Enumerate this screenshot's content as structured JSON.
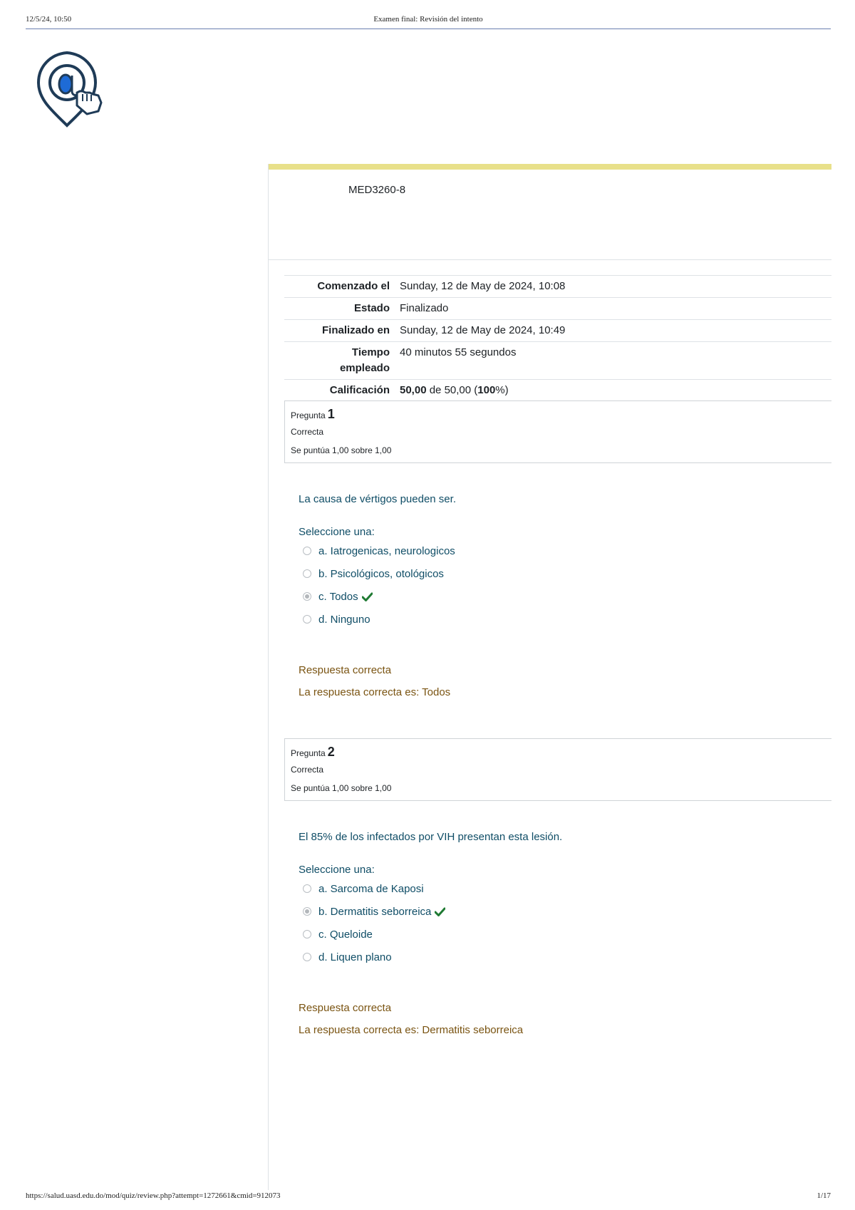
{
  "print": {
    "date": "12/5/24, 10:50",
    "title": "Examen final: Revisión del intento",
    "url": "https://salud.uasd.edu.do/mod/quiz/review.php?attempt=1272661&cmid=912073",
    "page": "1/17"
  },
  "course": {
    "name": "MED3260-8"
  },
  "summary": {
    "started_label": "Comenzado el",
    "started_value": "Sunday, 12 de May de 2024, 10:08",
    "state_label": "Estado",
    "state_value": "Finalizado",
    "finished_label": "Finalizado en",
    "finished_value": "Sunday, 12 de May de 2024, 10:49",
    "time_label_1": "Tiempo",
    "time_label_2": "empleado",
    "time_value": "40 minutos 55 segundos",
    "grade_label": "Calificación",
    "grade_bold": "50,00",
    "grade_mid": " de 50,00 (",
    "grade_pct": "100",
    "grade_end": "%)"
  },
  "questions": [
    {
      "label": "Pregunta",
      "number": "1",
      "state": "Correcta",
      "grade": "Se puntúa 1,00 sobre 1,00",
      "text": "La causa de vértigos pueden ser.",
      "prompt": "Seleccione una:",
      "options": [
        {
          "label": "a. Iatrogenicas, neurologicos",
          "checked": false
        },
        {
          "label": "b. Psicológicos, otológicos",
          "checked": false
        },
        {
          "label": "c. Todos",
          "checked": true
        },
        {
          "label": "d. Ninguno",
          "checked": false
        }
      ],
      "feedback": "Respuesta correcta",
      "right_answer": "La respuesta correcta es: Todos"
    },
    {
      "label": "Pregunta",
      "number": "2",
      "state": "Correcta",
      "grade": "Se puntúa 1,00 sobre 1,00",
      "text": "El 85% de los infectados por VIH presentan esta lesión.",
      "prompt": "Seleccione una:",
      "options": [
        {
          "label": "a. Sarcoma de Kaposi",
          "checked": false
        },
        {
          "label": "b. Dermatitis seborreica",
          "checked": true
        },
        {
          "label": "c. Queloide",
          "checked": false
        },
        {
          "label": "d. Liquen plano",
          "checked": false
        }
      ],
      "feedback": "Respuesta correcta",
      "right_answer": "La respuesta correcta es: Dermatitis seborreica"
    }
  ],
  "colors": {
    "accent": "#e8e08a",
    "question_text": "#0f4d66",
    "feedback": "#7a5412",
    "check": "#1f7a33"
  },
  "icons": {
    "logo": "at-sign-hand-pointer-logo",
    "correct": "check-icon"
  }
}
